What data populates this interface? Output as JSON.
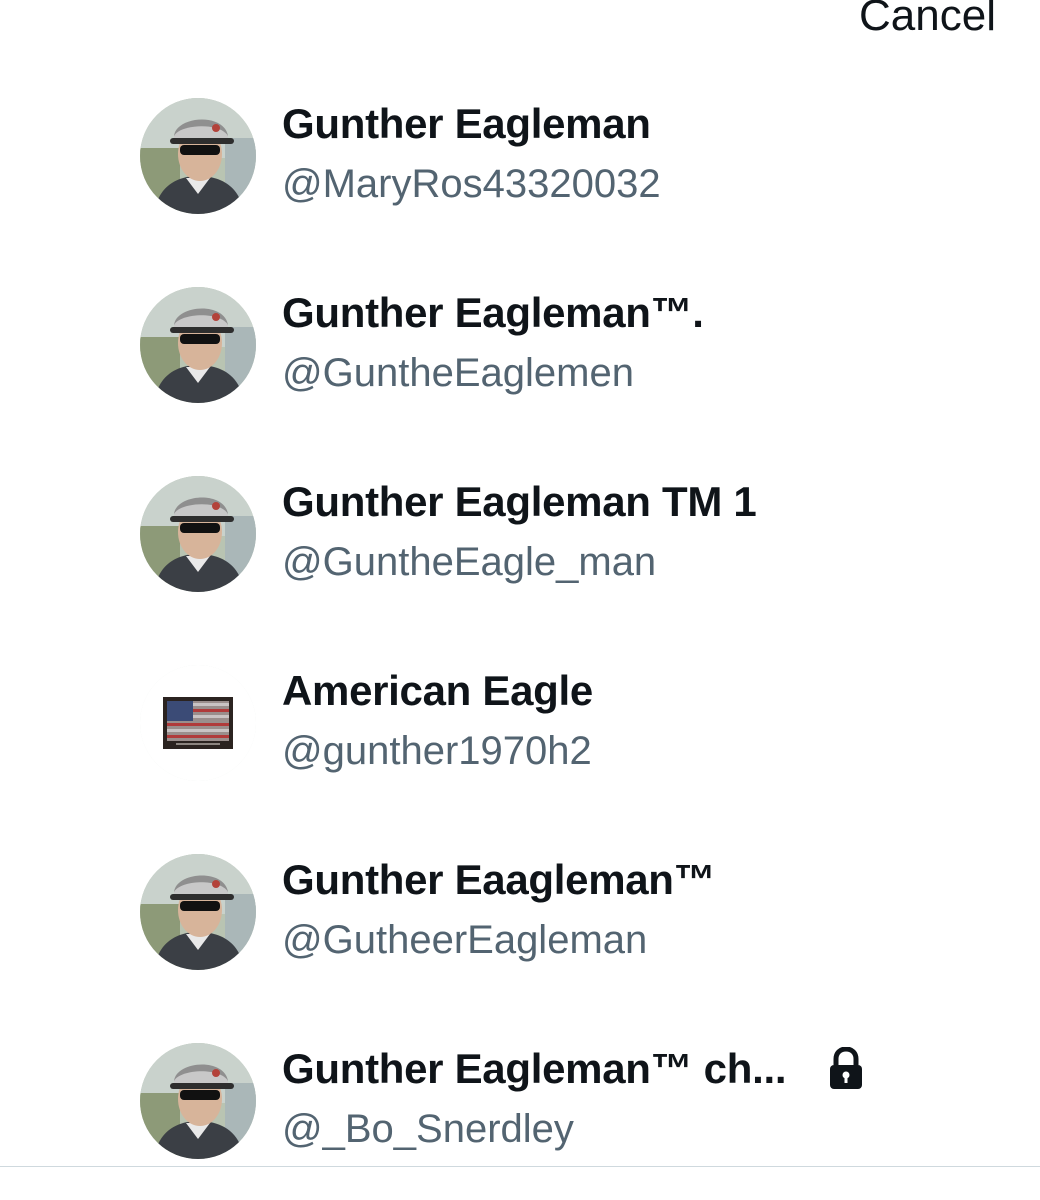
{
  "header": {
    "cancel_label": "Cancel"
  },
  "accounts": [
    {
      "name": "Gunther Eagleman",
      "handle": "@MaryRos43320032",
      "avatar": "man-cap-photo",
      "locked": false
    },
    {
      "name": "Gunther Eagleman™.",
      "handle": "@GuntheEaglemen",
      "avatar": "man-cap-photo",
      "locked": false
    },
    {
      "name": "Gunther Eagleman TM 1",
      "handle": "@GuntheEagle_man",
      "avatar": "man-cap-photo",
      "locked": false
    },
    {
      "name": "American Eagle",
      "handle": "@gunther1970h2",
      "avatar": "flag-picture",
      "locked": false
    },
    {
      "name": "Gunther Eaagleman™",
      "handle": "@GutheerEagleman",
      "avatar": "man-cap-photo",
      "locked": false
    },
    {
      "name": "Gunther Eagleman™ ch...",
      "handle": "@_Bo_Snerdley",
      "avatar": "man-cap-photo",
      "locked": true
    }
  ],
  "colors": {
    "name_text": "#0f1419",
    "handle_text": "#536471",
    "divider": "#cfd9de"
  }
}
